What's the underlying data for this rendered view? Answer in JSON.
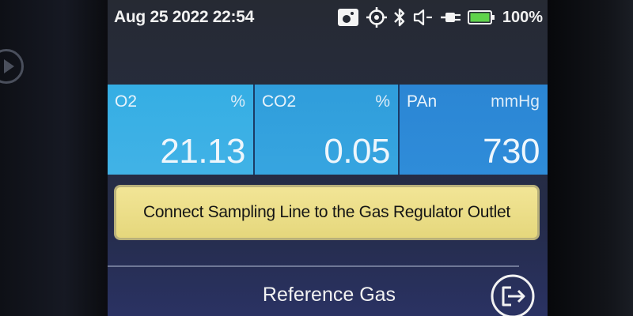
{
  "status_bar": {
    "datetime": "Aug 25 2022 22:54",
    "battery_percent": "100%",
    "icons": [
      "camera-icon",
      "target-icon",
      "bluetooth-icon",
      "speaker-icon",
      "power-plug-icon",
      "battery-icon"
    ],
    "battery_color": "#5fd34a"
  },
  "readings": [
    {
      "label": "O2",
      "unit": "%",
      "value": "21.13"
    },
    {
      "label": "CO2",
      "unit": "%",
      "value": "0.05"
    },
    {
      "label": "PAn",
      "unit": "mmHg",
      "value": "730"
    }
  ],
  "message": {
    "text": "Connect Sampling Line to the Gas Regulator Outlet"
  },
  "footer": {
    "reference_gas_label": "Reference Gas",
    "exit_icon": "exit-icon"
  },
  "colors": {
    "tile_blue": "#35aee4",
    "banner_yellow": "#f2e596"
  }
}
